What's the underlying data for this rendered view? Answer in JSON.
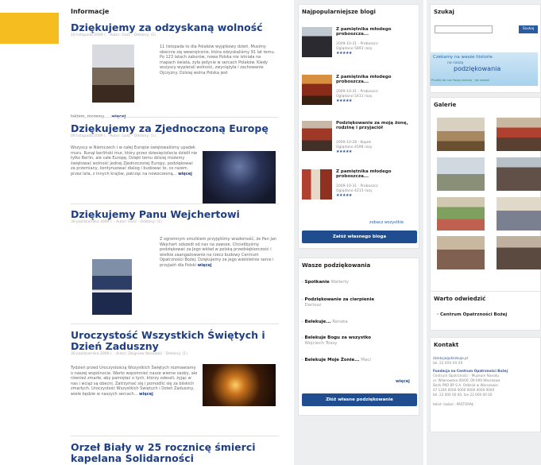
{
  "main": {
    "section_title": "Informacje",
    "articles": [
      {
        "title": "Dziękujemy za odzyskaną wolność",
        "meta": "10 listopada 2009 r. · Autor: Gość · Odsłony: (1)",
        "text": "11 listopada to dla Polaków wyjątkowy dzień. Musimy obecnie się wewnętrznie, która odzyskaliśmy 91 lat temu. Po 123 latach zaborów, nowa Polska nie istniała na mapach świata, żyła jedynie w sercach Polaków. Kiedy wszyscy wypierali wolność, zwyciężyła i zachowanie Ojczyzny. Dzisiaj wolna Polska jest",
        "text2": "faktem, możemy...",
        "more": "więcej"
      },
      {
        "title": "Dziękujemy za Zjednoczoną Europę",
        "meta": "09 listopada 2009 r. · Autor: Gość · Odsłony: (1)",
        "text": "Wszyscy w Niemczech i w całej Europie świętowaliśmy upadek muru. Runął berliński mur, który przez dziesięciolecia dzielił nie tylko Berlin, ale całe Europę. Dzięki temu dzisiaj możemy świętować wolność jednej Zjednoczonej Europy, podziękować za przemiany, kontynuować dialog i budować to, co razem przez lata, z innych krajów, patrząc na nowoczesną...",
        "more": "więcej"
      },
      {
        "title": "Dziękujemy Panu Wejchertowi",
        "meta": "30 października 2009 r. · Autor: Gość · Odsłony: (1)",
        "text": "Z ogromnym smutkiem przyjęliśmy wiadomość, że Pan Jan Wejchert odszedł od nas na zawsze. Chcielibyśmy podziękować za Jego wkład w polską przedsiębiorczość i wielkie zaangażowanie na rzecz budowy Centrum Opatrzności Bożej. Dziękujemy za jego wieloletnie serce i przyjaźń dla Polski",
        "more": "więcej"
      },
      {
        "title": "Uroczystość Wszystkich Świętych i Dzień Zaduszny",
        "meta": "30 października 2009 r. · Autor: Zbigniew Nosowski · Odsłony: (1)",
        "text": "Tydzień przed Uroczystością Wszystkich Świętych rozmawiamy o naszej wspólnocie. Warto wspomnieć nasze wierne osoby, ale również zmarłe, aby pamiętać o tych, którzy odeszli, żyjąc w nas i wciąż są obecni. Zatrzymać się i pomodlić się za bliskich zmarłych. Uroczystość Wszystkich Świętych i Dzień Zaduszny, wiele będzie w naszych sercach...",
        "more": "więcej"
      },
      {
        "title": "Orzeł Biały w 25 rocznicę śmierci kapelana Solidarności"
      }
    ]
  },
  "blogs": {
    "title": "Najpopularniejsze blogi",
    "items": [
      {
        "title": "Z pamiętnika młodego proboszcza...",
        "meta": "2009-10-31 · Proboszcz",
        "views": "Oglądano 5893 razy",
        "stars": "★★★★★"
      },
      {
        "title": "Z pamiętnika młodego proboszcza...",
        "meta": "2009-10-31 · Proboszcz",
        "views": "Oglądano 5411 razy",
        "stars": "★★★★★"
      },
      {
        "title": "Podziękowanie za moją żonę, rodzinę i przyjaciół",
        "meta": "2009-10-28 · Kopek",
        "views": "Oglądano 4598 razy",
        "stars": "★★★★★"
      },
      {
        "title": "Z pamiętnika młodego proboszcza...",
        "meta": "2009-10-31 · Proboszcz",
        "views": "Oglądano 4213 razy",
        "stars": "★★★★★"
      }
    ],
    "see_all": "zobacz wszystkie",
    "create_button": "Załóż własnego bloga"
  },
  "thanks": {
    "title": "Wasze podziękowania",
    "items": [
      {
        "title": "Spotkanie",
        "author": "Wallerty"
      },
      {
        "title": "Podziękowanie za cierpienie",
        "author": "Darlusz"
      },
      {
        "title": "Belekuje...",
        "author": "Renata"
      },
      {
        "title": "Belekuje Bogu za wszystko",
        "author": "Wojciech Tossy"
      },
      {
        "title": "Belekuje Moje Żonie...",
        "author": "Maci"
      }
    ],
    "more": "więcej",
    "send_button": "Złóż własne podziękowanie"
  },
  "search": {
    "title": "Szukaj",
    "button": "Szukaj",
    "placeholder": ""
  },
  "banner": {
    "line1": "Czekamy na wasze historie",
    "line2": "na naszą",
    "line3": "podziękowania",
    "footer": "Prześlij do nas Twoją historię · Jak wysłać"
  },
  "gallery": {
    "title": "Galerie"
  },
  "links": {
    "title": "Warto odwiedzić",
    "item": "Centrum Opatrzności Bożej"
  },
  "contact": {
    "title": "Kontakt",
    "email": "dziekuje@dziekuje.pl",
    "email_label": "tel. 22 XXX XX XX",
    "org": "Fundacja na Centrum Opatrzności Bożej",
    "lines": [
      "Centrum Opatrzności - Muzeum Narodu",
      "ul. Wilanowska 00/00, 00-000 Warszawa",
      "Bank PKO BP S.A. Oddział w Warszawie",
      "07 1240 0000 0000 0000 0000 0000",
      "tel. 22 000 00 00, fax 22 000 00 00"
    ],
    "footer": "tekst: Izobel · PASTORAŁ"
  },
  "colors": {
    "accent": "#f5bd1f",
    "link": "#1f3f85",
    "button": "#1f4d8f"
  }
}
